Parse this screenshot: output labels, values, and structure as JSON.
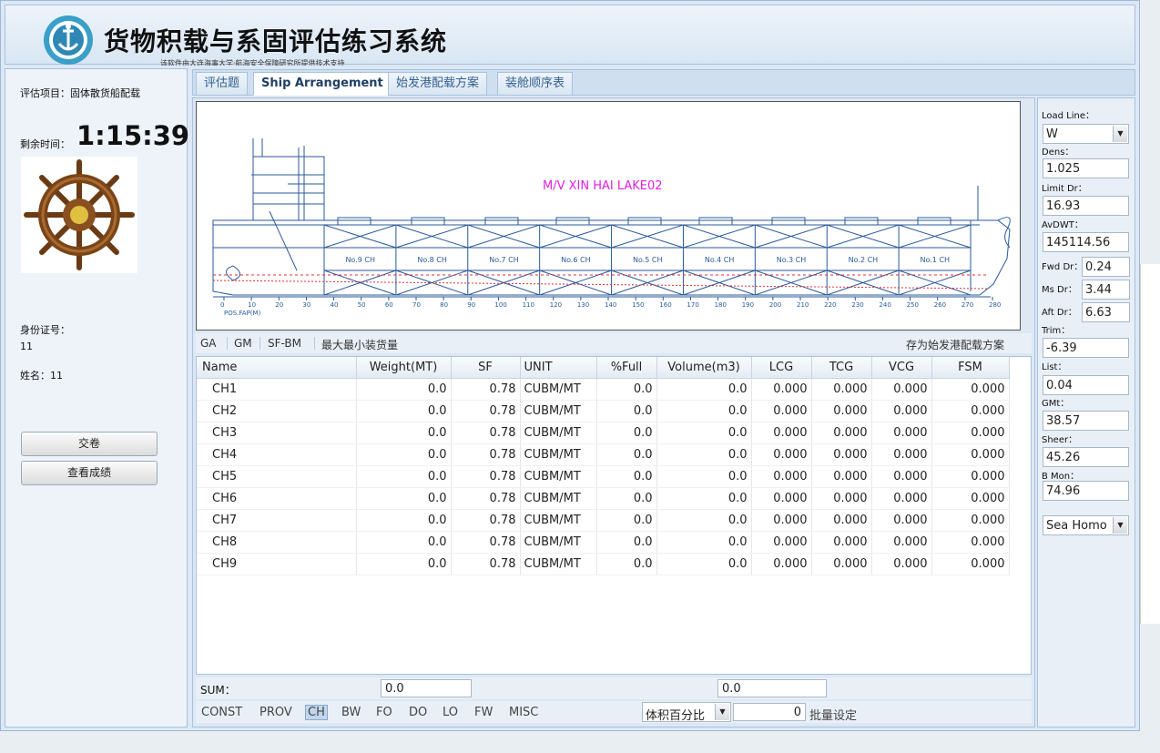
{
  "app": {
    "title": "货物积载与系固评估练习系统",
    "subtitle": "该软件由大连海事大学·航海安全保障研究所提供技术支持"
  },
  "left_panel": {
    "project_label": "评估项目：固体散货船配载",
    "time_label": "剩余时间：",
    "time_value": "1:15:39",
    "id_label": "身份证号：",
    "id_value": "11",
    "name_label": "姓名：11",
    "submit_button": "交卷",
    "view_score_button": "查看成绩"
  },
  "tabs": [
    {
      "label": "评估题",
      "active": false
    },
    {
      "label": "Ship Arrangement",
      "active": true
    },
    {
      "label": "始发港配载方案",
      "active": false
    },
    {
      "label": "装舱顺序表",
      "active": false
    }
  ],
  "drawing": {
    "ship_name": "M/V XIN HAI LAKE02",
    "holds": [
      "No.9 CH",
      "No.8 CH",
      "No.7 CH",
      "No.6 CH",
      "No.5 CH",
      "No.4 CH",
      "No.3 CH",
      "No.2 CH",
      "No.1 CH"
    ],
    "scale_ticks": [
      "0",
      "10",
      "20",
      "30",
      "40",
      "50",
      "60",
      "70",
      "80",
      "90",
      "100",
      "110",
      "120",
      "130",
      "140",
      "150",
      "160",
      "170",
      "180",
      "190",
      "200",
      "210",
      "220",
      "230",
      "240",
      "250",
      "260",
      "270",
      "280"
    ],
    "scale_label": "POS.FAP(M)"
  },
  "sub_toolbar": {
    "items": [
      "GA",
      "GM",
      "SF-BM",
      "最大最小装货量"
    ],
    "save_label": "存为始发港配载方案"
  },
  "table": {
    "columns": [
      "Name",
      "Weight(MT)",
      "SF",
      "UNIT",
      "%Full",
      "Volume(m3)",
      "LCG",
      "TCG",
      "VCG",
      "FSM"
    ],
    "rows": [
      [
        "CH1",
        "0.0",
        "0.78",
        "CUBM/MT",
        "0.0",
        "0.0",
        "0.000",
        "0.000",
        "0.000",
        "0.000"
      ],
      [
        "CH2",
        "0.0",
        "0.78",
        "CUBM/MT",
        "0.0",
        "0.0",
        "0.000",
        "0.000",
        "0.000",
        "0.000"
      ],
      [
        "CH3",
        "0.0",
        "0.78",
        "CUBM/MT",
        "0.0",
        "0.0",
        "0.000",
        "0.000",
        "0.000",
        "0.000"
      ],
      [
        "CH4",
        "0.0",
        "0.78",
        "CUBM/MT",
        "0.0",
        "0.0",
        "0.000",
        "0.000",
        "0.000",
        "0.000"
      ],
      [
        "CH5",
        "0.0",
        "0.78",
        "CUBM/MT",
        "0.0",
        "0.0",
        "0.000",
        "0.000",
        "0.000",
        "0.000"
      ],
      [
        "CH6",
        "0.0",
        "0.78",
        "CUBM/MT",
        "0.0",
        "0.0",
        "0.000",
        "0.000",
        "0.000",
        "0.000"
      ],
      [
        "CH7",
        "0.0",
        "0.78",
        "CUBM/MT",
        "0.0",
        "0.0",
        "0.000",
        "0.000",
        "0.000",
        "0.000"
      ],
      [
        "CH8",
        "0.0",
        "0.78",
        "CUBM/MT",
        "0.0",
        "0.0",
        "0.000",
        "0.000",
        "0.000",
        "0.000"
      ],
      [
        "CH9",
        "0.0",
        "0.78",
        "CUBM/MT",
        "0.0",
        "0.0",
        "0.000",
        "0.000",
        "0.000",
        "0.000"
      ]
    ]
  },
  "sum": {
    "label": "SUM：",
    "weight": "0.0",
    "volume": "0.0"
  },
  "bottom_bar": {
    "tabs": [
      "CONST",
      "PROV",
      "CH",
      "BW",
      "FO",
      "DO",
      "LO",
      "FW",
      "MISC"
    ],
    "selected_tab": "CH",
    "mode_select": "体积百分比",
    "batch_value": "0",
    "batch_label": "批量设定"
  },
  "right_panel": {
    "load_line_label": "Load Line：",
    "load_line_value": "W",
    "dens_label": "Dens：",
    "dens_value": "1.025",
    "limit_dr_label": "Limit Dr：",
    "limit_dr_value": "16.93",
    "avdwt_label": "AvDWT：",
    "avdwt_value": "145114.56",
    "fwd_dr_label": "Fwd Dr：",
    "fwd_dr_value": "0.24",
    "ms_dr_label": "Ms Dr：",
    "ms_dr_value": "3.44",
    "aft_dr_label": "Aft Dr：",
    "aft_dr_value": "6.63",
    "trim_label": "Trim：",
    "trim_value": "-6.39",
    "list_label": "List：",
    "list_value": "0.04",
    "gmt_label": "GMt：",
    "gmt_value": "38.57",
    "sheer_label": "Sheer：",
    "sheer_value": "45.26",
    "bmon_label": "B Mon：",
    "bmon_value": "74.96",
    "sea_select": "Sea Homo"
  },
  "colors": {
    "accent": "#35608f",
    "ship_name": "#e020e0",
    "drawing_lines": "#2a5a9a",
    "waterline": "#e03030"
  }
}
